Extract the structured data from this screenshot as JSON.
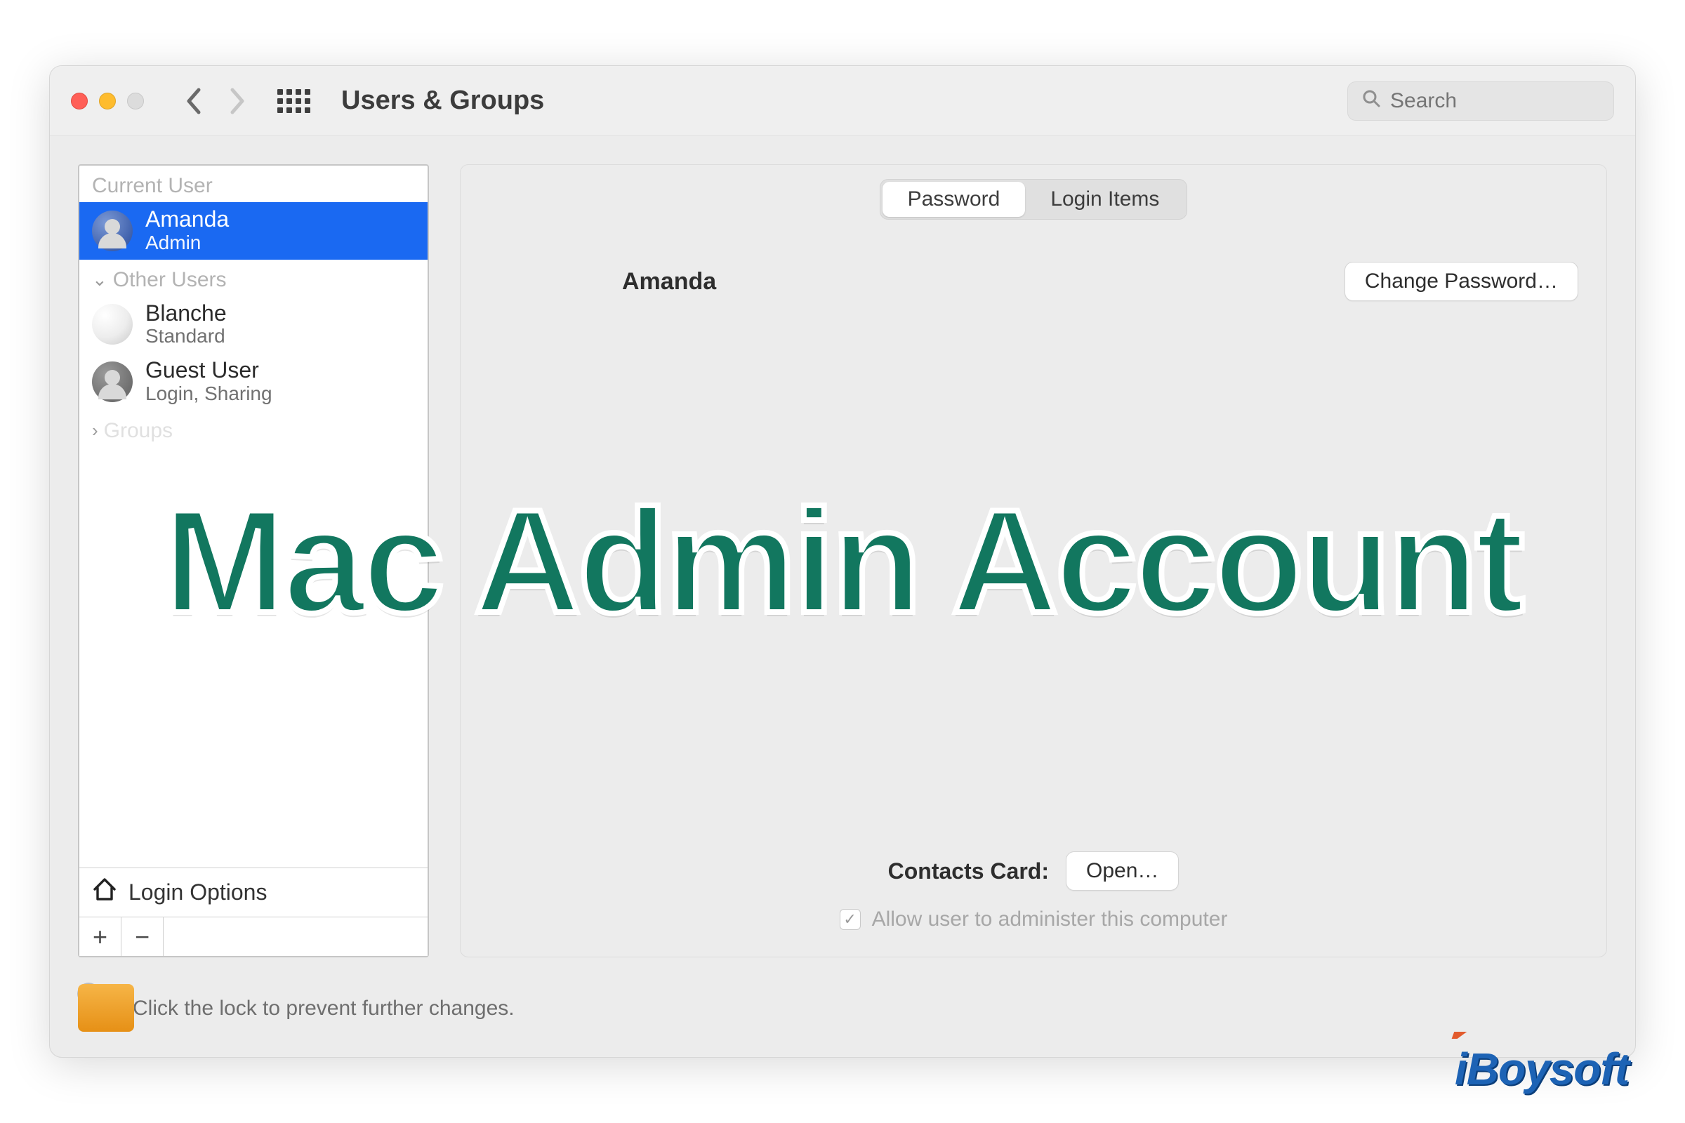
{
  "toolbar": {
    "title": "Users & Groups",
    "search_placeholder": "Search"
  },
  "sidebar": {
    "current_user_label": "Current User",
    "other_users_label": "Other Users",
    "groups_label": "Groups",
    "login_options_label": "Login Options",
    "users": {
      "current": {
        "name": "Amanda",
        "role": "Admin"
      },
      "others": [
        {
          "name": "Blanche",
          "role": "Standard"
        },
        {
          "name": "Guest User",
          "role": "Login, Sharing"
        }
      ]
    }
  },
  "tabs": {
    "password": "Password",
    "login_items": "Login Items",
    "active": "password"
  },
  "content": {
    "display_name": "Amanda",
    "change_password_label": "Change Password…",
    "contacts_card_label": "Contacts Card:",
    "open_label": "Open…",
    "admin_checkbox_label": "Allow user to administer this computer",
    "admin_checkbox_checked": true,
    "admin_checkbox_enabled": false
  },
  "footer": {
    "lock_text": "Click the lock to prevent further changes."
  },
  "overlay": {
    "headline": "Mac Admin Account",
    "watermark": "iBoysoft"
  }
}
